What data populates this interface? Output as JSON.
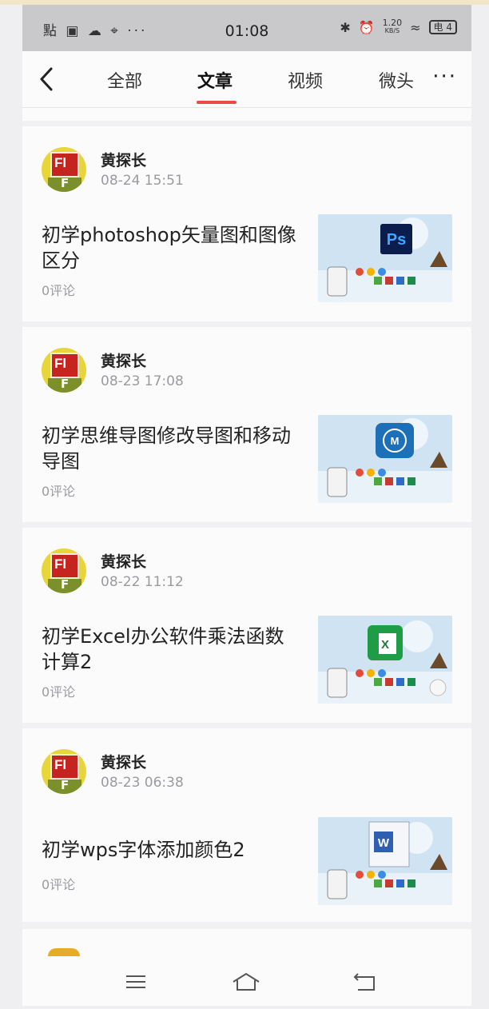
{
  "status_bar": {
    "left_icons": "點 ▣ ☁ ⌖ ···",
    "time": "01:08",
    "right_icons": [
      "bluetooth-icon",
      "alarm-icon",
      "network-speed",
      "wifi-icon",
      "battery-icon"
    ],
    "net_speed_value": "1.20",
    "net_speed_unit": "KB/S",
    "battery_label": "电 4"
  },
  "nav": {
    "tabs": [
      "全部",
      "文章",
      "视频",
      "微头"
    ],
    "active_tab": "文章",
    "more": "···"
  },
  "articles": [
    {
      "author": "黄探长",
      "date": "08-24 15:51",
      "title": "初学photoshop矢量图和图像区分",
      "comments": "0评论",
      "thumb_icon": "Ps"
    },
    {
      "author": "黄探长",
      "date": "08-23 17:08",
      "title": "初学思维导图修改导图和移动导图",
      "comments": "0评论",
      "thumb_icon": "M"
    },
    {
      "author": "黄探长",
      "date": "08-22 11:12",
      "title": "初学Excel办公软件乘法函数计算2",
      "comments": "0评论",
      "thumb_icon": "X"
    },
    {
      "author": "黄探长",
      "date": "08-23 06:38",
      "title": "初学wps字体添加颜色2",
      "comments": "0评论",
      "thumb_icon": "W"
    }
  ],
  "avatar_text": {
    "top": "Fl",
    "bottom": "F"
  },
  "colors": {
    "accent": "#ea4b45",
    "card_bg": "#fbfbfc",
    "muted_text": "#9b9b9f"
  }
}
